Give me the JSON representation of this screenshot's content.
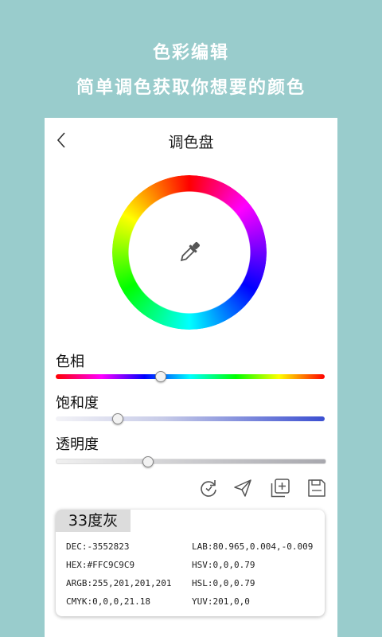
{
  "promo": {
    "title": "色彩编辑",
    "subtitle": "简单调色获取你想要的颜色"
  },
  "topbar": {
    "back_icon": "chevron-left-icon",
    "title": "调色盘"
  },
  "wheel": {
    "center_icon": "eyedropper-icon"
  },
  "sliders": {
    "hue": {
      "label": "色相",
      "value": 0.39
    },
    "saturation": {
      "label": "饱和度",
      "value": 0.23
    },
    "alpha": {
      "label": "透明度",
      "value": 0.34
    }
  },
  "tools": [
    "refresh-icon",
    "send-icon",
    "add-copy-icon",
    "save-icon"
  ],
  "color_info": {
    "name": "33度灰",
    "left": [
      "DEC:-3552823",
      "HEX:#FFC9C9C9",
      "ARGB:255,201,201,201",
      "CMYK:0,0,0,21.18"
    ],
    "right": [
      "LAB:80.965,0.004,-0.009",
      "HSV:0,0,0.79",
      "HSL:0,0,0.79",
      "YUV:201,0,0"
    ]
  },
  "colors": {
    "background": "#99cccc",
    "panel": "#ffffff",
    "name_tab": "#dcdcdc"
  }
}
